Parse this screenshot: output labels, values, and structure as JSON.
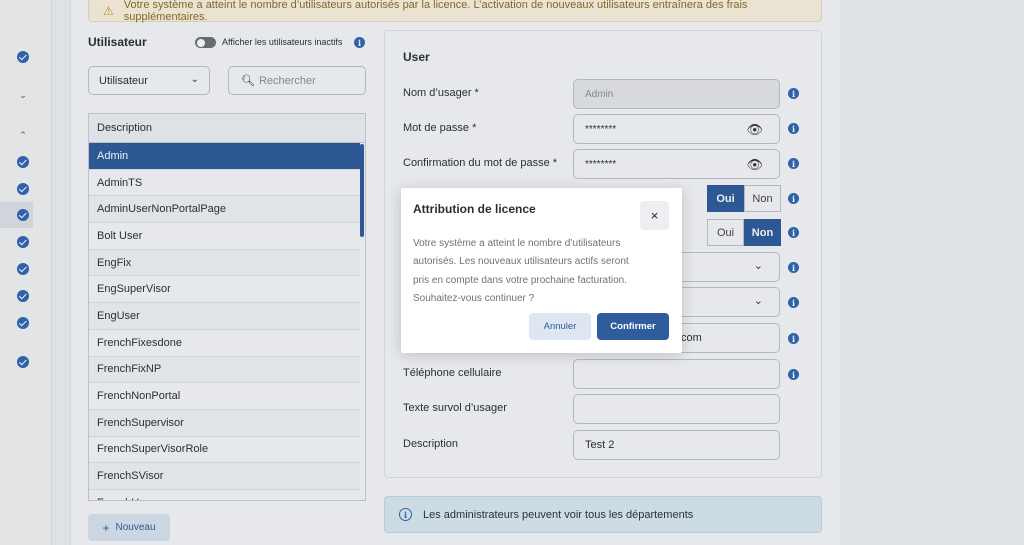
{
  "warning": {
    "icon": "warning-icon",
    "text": "Votre système a atteint le nombre d’utilisateurs autorisés par la licence. L’activation de nouveaux utilisateurs entraînera des frais supplémentaires."
  },
  "left_panel": {
    "title": "Utilisateur",
    "toggle_label": "Afficher les utilisateurs inactifs",
    "filter_value": "Utilisateur",
    "search_placeholder": "Rechercher",
    "list_header": "Description",
    "users": [
      "Admin",
      "AdminTS",
      "AdminUserNonPortalPage",
      "Bolt User",
      "EngFix",
      "EngSuperVisor",
      "EngUser",
      "FrenchFixesdone",
      "FrenchFixNP",
      "FrenchNonPortal",
      "FrenchSupervisor",
      "FrenchSuperVisorRole",
      "FrenchSVisor",
      "FrenchUser"
    ],
    "selected_index": 0,
    "new_button": "Nouveau"
  },
  "form": {
    "title": "User",
    "username_label": "Nom d’usager *",
    "username_value": "Admin",
    "password_label": "Mot de passe *",
    "password_value": "********",
    "confirm_label": "Confirmation du mot de passe *",
    "confirm_value": "********",
    "yes": "Oui",
    "no": "Non",
    "email_partial": ".com",
    "mobile_label": "Téléphone cellulaire",
    "hover_label": "Texte survol d’usager",
    "description_label": "Description",
    "description_value": "Test 2"
  },
  "note": "Les administrateurs peuvent voir tous les départements",
  "modal": {
    "title": "Attribution de licence",
    "close": "×",
    "body": "Votre système a atteint le nombre d’utilisateurs autorisés. Les nouveaux utilisateurs actifs seront pris en compte dans votre prochaine facturation. Souhaitez-vous continuer ?",
    "cancel": "Annuler",
    "confirm": "Confirmer"
  },
  "colors": {
    "primary": "#2f5c9c",
    "warning_bg": "#fbf2df",
    "info_bg": "#dcebf1"
  }
}
